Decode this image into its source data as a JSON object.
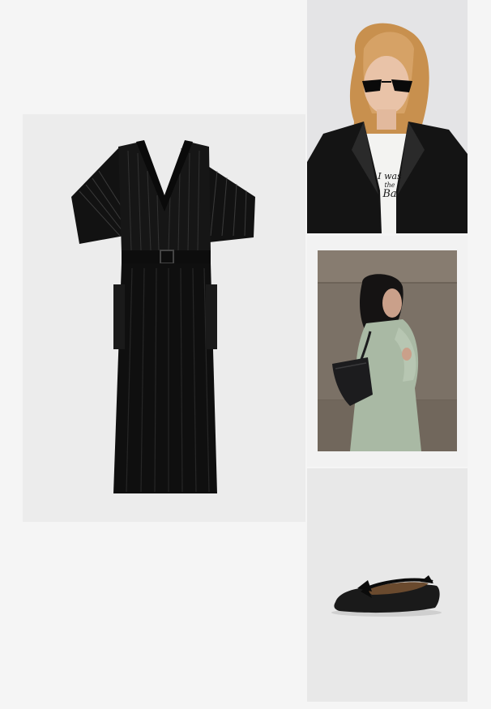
{
  "page": {
    "background": "#f5f5f5"
  },
  "tiles": {
    "dress": {
      "icon": "black-pleated-midi-dress"
    },
    "jacket_model": {
      "icon": "model-leather-jacket-sunglasses",
      "tee_print": [
        "I was",
        "the",
        "Ba"
      ]
    },
    "bag_model": {
      "icon": "model-green-coat-shoulder-bag"
    },
    "shoe": {
      "icon": "black-leather-ballet-flat"
    }
  },
  "colors": {
    "dress": "#111111",
    "jacket": "#141414",
    "coat": "#a9b9a4",
    "bag": "#1c1c1e",
    "wall": "#7b7166",
    "hair_blonde": "#c8904e"
  }
}
